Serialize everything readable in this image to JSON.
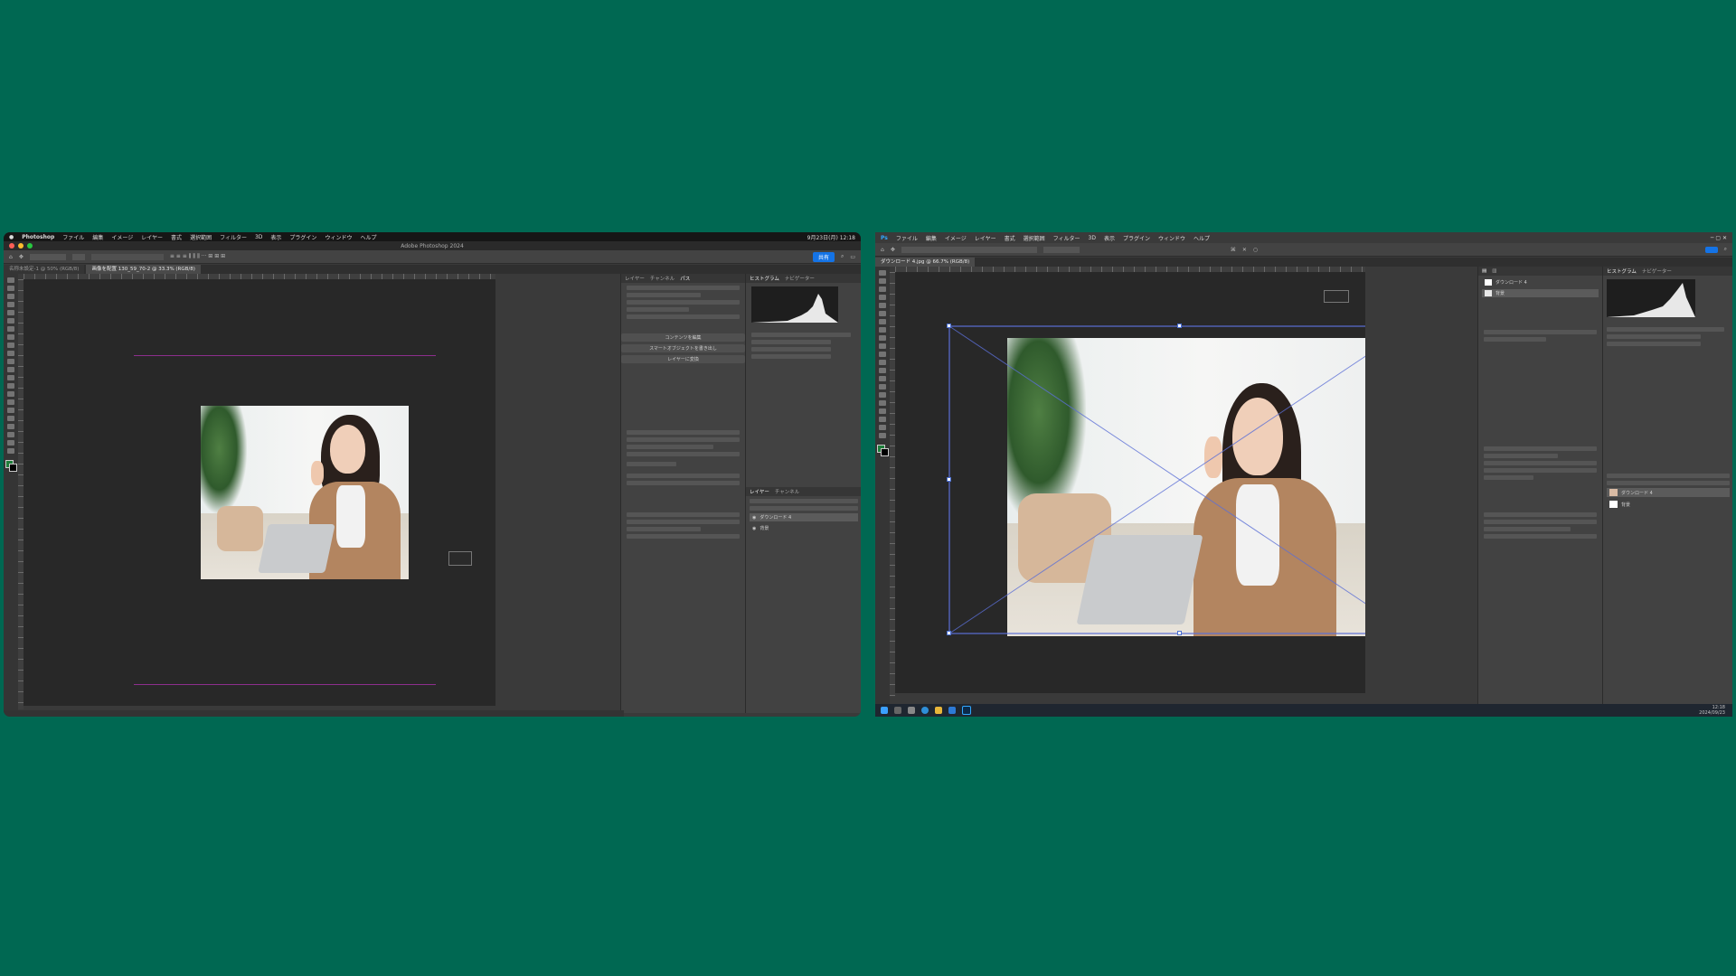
{
  "colors": {
    "background": "#006852",
    "accent": "#1473e6",
    "guide": "#8d2f8d",
    "transform": "#5b6fd6"
  },
  "mac": {
    "sysbar": {
      "app": "Photoshop",
      "menus": [
        "ファイル",
        "編集",
        "イメージ",
        "レイヤー",
        "書式",
        "選択範囲",
        "フィルター",
        "3D",
        "表示",
        "プラグイン",
        "ウィンドウ",
        "ヘルプ"
      ],
      "clock": "9月23日(月) 12:18"
    },
    "title": "Adobe Photoshop 2024",
    "share_label": "共有",
    "tabs": [
      "名称未設定-1 @ 50% (RGB/8)",
      "画像を配置 130_59_70-2 @ 33.3% (RGB/8)"
    ],
    "panel_tabs": [
      "ヒストグラム",
      "ナビゲーター"
    ],
    "props_tabs": [
      "レイヤー",
      "チャンネル",
      "パス"
    ],
    "buttons": [
      "コンテンツを編集",
      "スマートオブジェクトを書き出し",
      "レイヤーに変換"
    ],
    "layers": [
      {
        "name": "ダウンロード 4"
      },
      {
        "name": "背景"
      }
    ]
  },
  "pc": {
    "menus": [
      "ファイル",
      "編集",
      "イメージ",
      "レイヤー",
      "書式",
      "選択範囲",
      "フィルター",
      "3D",
      "表示",
      "プラグイン",
      "ウィンドウ",
      "ヘルプ"
    ],
    "doc_tab": "ダウンロード 4.jpg @ 66.7% (RGB/8)",
    "panel_tabs": [
      "ヒストグラム",
      "ナビゲーター"
    ],
    "layers": [
      {
        "name": "ダウンロード 4"
      },
      {
        "name": "背景"
      }
    ],
    "taskbar_time": "12:18",
    "taskbar_date": "2024/09/23"
  }
}
